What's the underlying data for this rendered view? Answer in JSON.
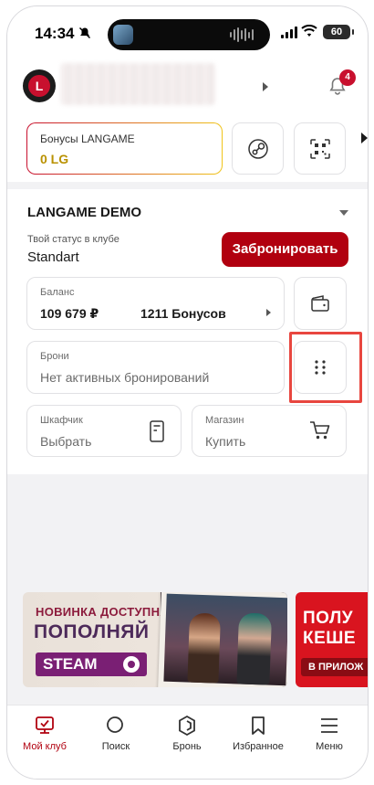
{
  "status_bar": {
    "time": "14:34",
    "battery": "60"
  },
  "header": {
    "notifications_count": "4"
  },
  "bonus": {
    "title": "Бонусы LANGAME",
    "value": "0 LG"
  },
  "club": {
    "name": "LANGAME DEMO",
    "status_label": "Твой статус в клубе",
    "status_value": "Standart",
    "book_button": "Забронировать"
  },
  "balance": {
    "label": "Баланс",
    "amount": "109 679 ₽",
    "bonuses": "1211 Бонусов"
  },
  "bookings": {
    "label": "Брони",
    "value": "Нет активных бронирований"
  },
  "locker": {
    "label": "Шкафчик",
    "value": "Выбрать"
  },
  "shop": {
    "label": "Магазин",
    "value": "Купить"
  },
  "banner1": {
    "line1": "НОВИНКА ДОСТУПНА!",
    "line2": "ПОПОЛНЯЙ",
    "line3": "STEAM"
  },
  "banner2": {
    "line1": "ПОЛУ",
    "line2": "КЕШЕ",
    "line3": "В ПРИЛОЖ"
  },
  "tabs": [
    {
      "label": "Мой клуб",
      "icon": "my-club-icon",
      "active": true
    },
    {
      "label": "Поиск",
      "icon": "search-icon",
      "active": false
    },
    {
      "label": "Бронь",
      "icon": "booking-logo-icon",
      "active": false
    },
    {
      "label": "Избранное",
      "icon": "bookmark-icon",
      "active": false
    },
    {
      "label": "Меню",
      "icon": "menu-icon",
      "active": false
    }
  ],
  "colors": {
    "accent": "#b1000f",
    "bonus_gold": "#b99100",
    "highlight": "#e8463f"
  }
}
